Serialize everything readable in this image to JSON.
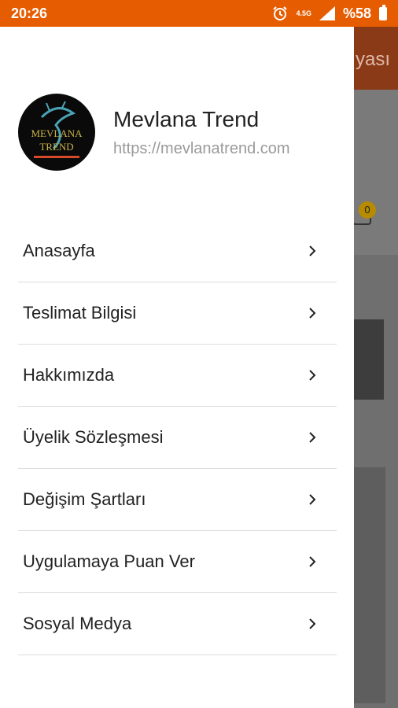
{
  "status_bar": {
    "time": "20:26",
    "network": "4.5G",
    "battery": "%58"
  },
  "background": {
    "header_partial_title": "yası",
    "cart_count": "0"
  },
  "drawer": {
    "store_name": "Mevlana Trend",
    "store_url": "https://mevlanatrend.com",
    "logo_text": [
      "MEVLANA",
      "TREND"
    ],
    "menu": [
      {
        "label": "Anasayfa"
      },
      {
        "label": "Teslimat Bilgisi"
      },
      {
        "label": "Hakkımızda"
      },
      {
        "label": "Üyelik Sözleşmesi"
      },
      {
        "label": "Değişim Şartları"
      },
      {
        "label": "Uygulamaya Puan Ver"
      },
      {
        "label": "Sosyal Medya"
      }
    ]
  }
}
